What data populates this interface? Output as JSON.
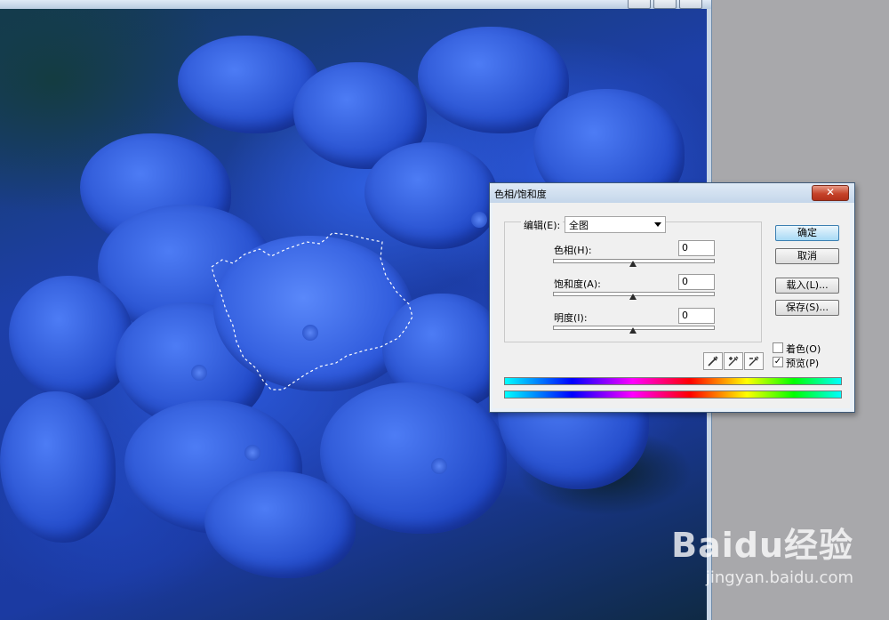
{
  "dialog": {
    "title": "色相/饱和度",
    "close_symbol": "✕",
    "edit_label": "编辑(E):",
    "edit_value": "全图",
    "sliders": [
      {
        "label": "色相(H):",
        "value": "0",
        "level": 0.5
      },
      {
        "label": "饱和度(A):",
        "value": "0",
        "level": 0.5
      },
      {
        "label": "明度(I):",
        "value": "0",
        "level": 0.5
      }
    ],
    "buttons": {
      "ok": "确定",
      "cancel": "取消",
      "load": "载入(L)...",
      "save": "保存(S)..."
    },
    "checkboxes": {
      "colorize": {
        "label": "着色(O)",
        "checked": false
      },
      "preview": {
        "label": "预览(P)",
        "checked": true
      }
    },
    "eyedroppers": [
      "eyedropper-icon",
      "eyedropper-plus-icon",
      "eyedropper-minus-icon"
    ]
  },
  "watermark": {
    "logo": "Baidu经验",
    "site": "jingyan.baidu.com"
  },
  "colors": {
    "annotation_arrow": "#e8372c",
    "close_button": "#c6432a",
    "default_button": "#a7d9f5"
  }
}
